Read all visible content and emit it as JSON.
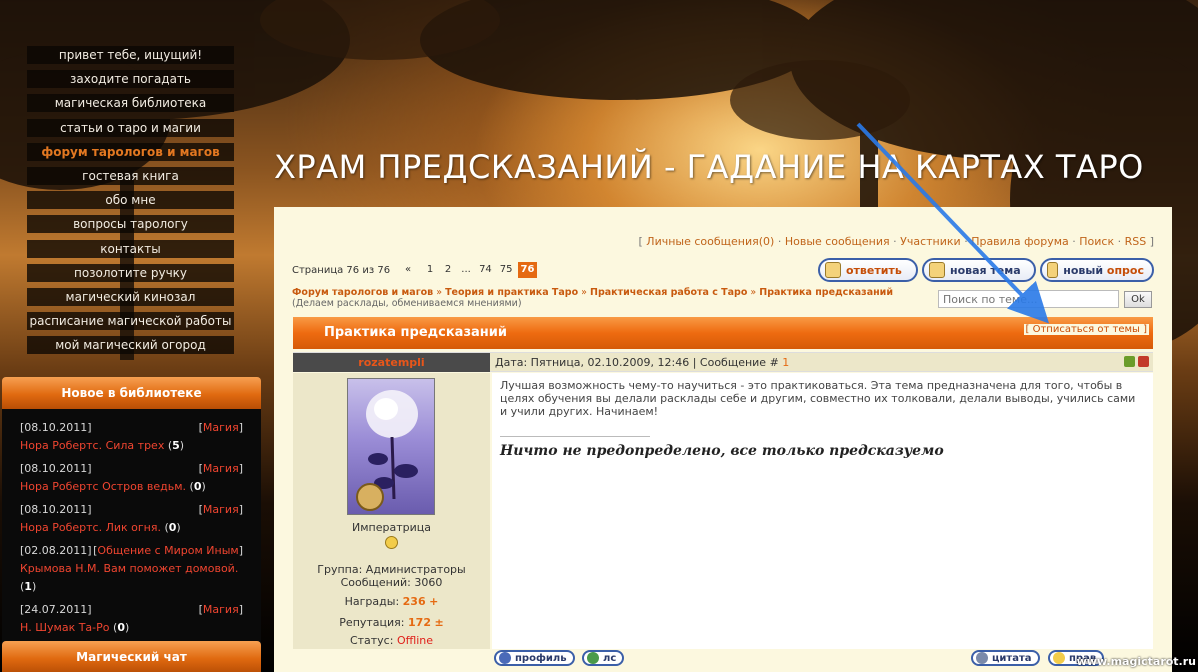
{
  "site": {
    "title": "ХРАМ ПРЕДСКАЗАНИЙ - ГАДАНИЕ НА КАРТАХ ТАРО",
    "watermark": "www.magictarot.ru"
  },
  "nav": {
    "items": [
      {
        "label": "привет тебе, ищущий!",
        "active": false
      },
      {
        "label": "заходите погадать",
        "active": false
      },
      {
        "label": "магическая библиотека",
        "active": false
      },
      {
        "label": "статьи о таро и магии",
        "active": false
      },
      {
        "label": "форум тарологов и магов",
        "active": true
      },
      {
        "label": "гостевая книга",
        "active": false
      },
      {
        "label": "обо мне",
        "active": false
      },
      {
        "label": "вопросы тарологу",
        "active": false
      },
      {
        "label": "контакты",
        "active": false
      },
      {
        "label": "позолотите ручку",
        "active": false
      },
      {
        "label": "магический кинозал",
        "active": false
      },
      {
        "label": "расписание магической работы",
        "active": false
      },
      {
        "label": "мой магический огород",
        "active": false
      }
    ]
  },
  "library": {
    "heading": "Новое в библиотеке",
    "items": [
      {
        "date": "[08.10.2011]",
        "category": "Магия",
        "title": "Нора Робертс. Сила трех",
        "count": "5"
      },
      {
        "date": "[08.10.2011]",
        "category": "Магия",
        "title": "Нора Робертс Остров ведьм.",
        "count": "0"
      },
      {
        "date": "[08.10.2011]",
        "category": "Магия",
        "title": "Нора Робертс. Лик огня.",
        "count": "0"
      },
      {
        "date": "[02.08.2011]",
        "category": "Общение с Миром Иным",
        "title": "Крымова Н.М. Вам поможет домовой.",
        "count": "1"
      },
      {
        "date": "[24.07.2011]",
        "category": "Магия",
        "title": "Н. Шумак Та-Ро",
        "count": "0"
      }
    ]
  },
  "chat": {
    "heading": "Магический чат"
  },
  "forum": {
    "top_links": {
      "open": "[",
      "messages": "Личные сообщения(0)",
      "new_messages": "Новые сообщения",
      "members": "Участники",
      "rules": "Правила форума",
      "search": "Поиск",
      "rss": "RSS",
      "close": "]"
    },
    "pager": {
      "label": "Страница 76 из 76",
      "arrow": "«",
      "pages": [
        "1",
        "2",
        "...",
        "74",
        "75"
      ],
      "current": "76"
    },
    "buttons": {
      "reply": "ответить",
      "new_topic": "новая тема",
      "new_poll_a": "новый",
      "new_poll_b": "опрос"
    },
    "breadcrumb": {
      "c1": "Форум тарологов и магов",
      "c2": "Теория и практика Таро",
      "c3": "Практическая работа с Таро",
      "c4": "Практика предсказаний",
      "desc": "(Делаем расклады, обмениваемся мнениями)",
      "sep": "»"
    },
    "search_placeholder": "Поиск по теме...",
    "ok_label": "Ok",
    "topic_title": "Практика предсказаний",
    "unsubscribe": "[ Отписаться от темы ]",
    "post": {
      "author": "rozatempli",
      "meta_prefix": "Дата: Пятница, 02.10.2009, 12:46 | Сообщение #",
      "meta_num": "1",
      "rank": "Императрица",
      "group": "Группа: Администраторы",
      "messages": "Сообщений: 3060",
      "awards_label": "Награды:",
      "awards_value": "236",
      "awards_plus": "+",
      "rep_label": "Репутация:",
      "rep_value": "172",
      "rep_pm": "±",
      "status_label": "Статус:",
      "status_value": "Offline",
      "body": "Лучшая возможность чему-то научиться - это практиковаться. Эта тема предназначена для того, чтобы в целях обучения вы делали расклады себе и другим, совместно их толковали, делали выводы, учились сами и учили других. Начинаем!",
      "signature": "Ничто не предопределено, все только предсказуемо",
      "profile_btn": "профиль",
      "pm_btn": "лс",
      "quote_btn": "цитата",
      "edit_btn": "прав"
    }
  },
  "colors": {
    "accent": "#e56a12",
    "link": "#c85a0f",
    "button_border": "#3b5fa8"
  }
}
